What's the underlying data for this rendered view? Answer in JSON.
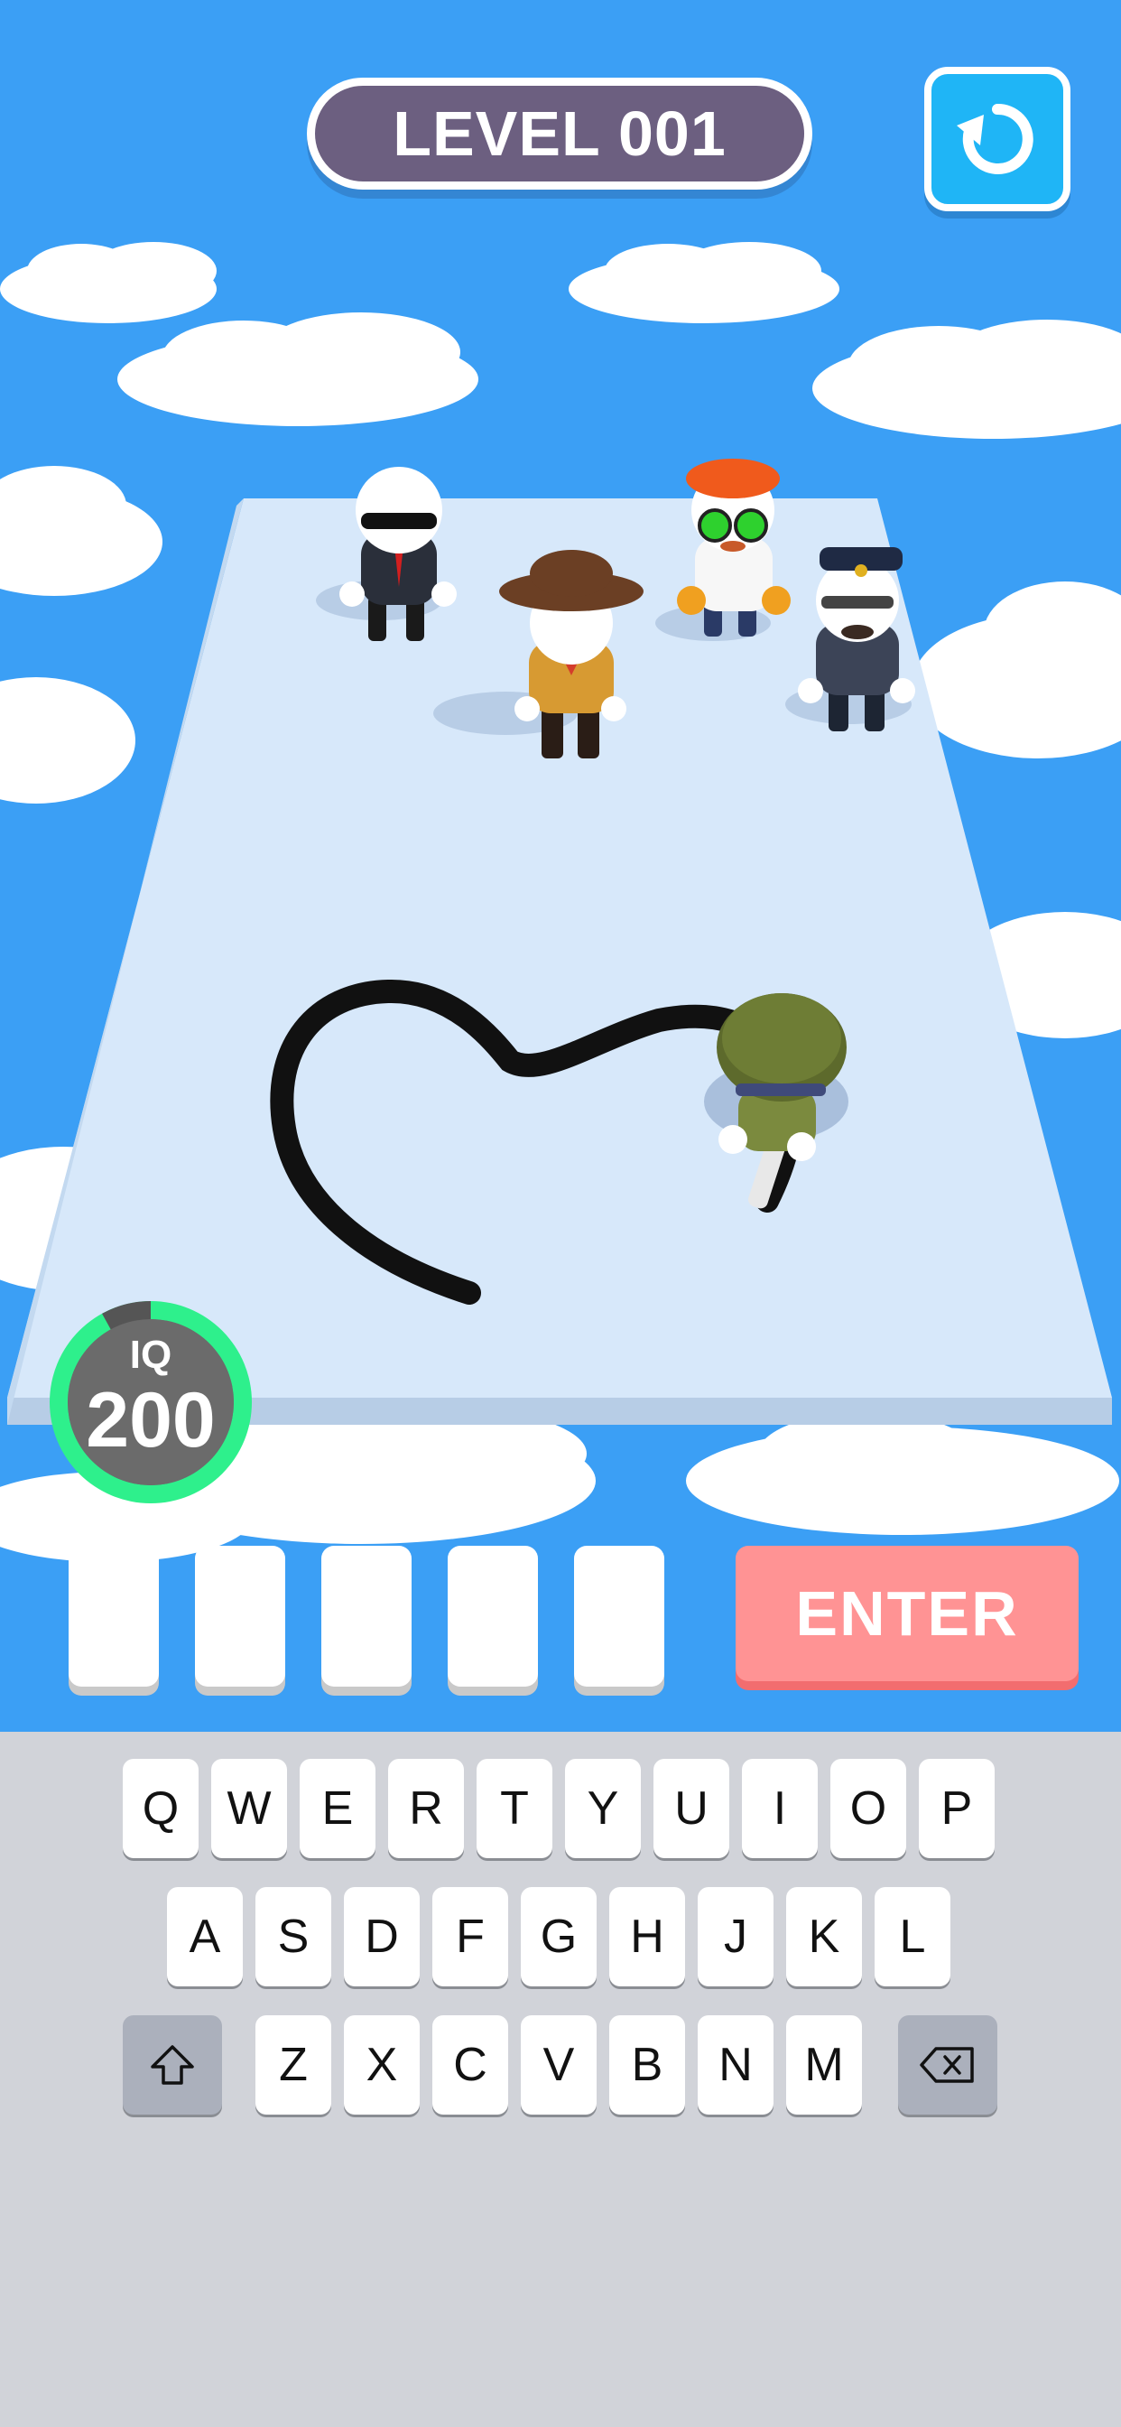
{
  "header": {
    "level_label": "LEVEL 001",
    "restart_icon": "restart-icon"
  },
  "iq": {
    "label": "IQ",
    "value": "200",
    "ring_progress_percent": 92
  },
  "answer": {
    "slot_count": 5,
    "enter_label": "ENTER"
  },
  "characters": [
    "secret-agent",
    "cowboy",
    "mad-scientist",
    "police-officer",
    "soldier"
  ],
  "keyboard": {
    "row1": [
      "Q",
      "W",
      "E",
      "R",
      "T",
      "Y",
      "U",
      "I",
      "O",
      "P"
    ],
    "row2": [
      "A",
      "S",
      "D",
      "F",
      "G",
      "H",
      "J",
      "K",
      "L"
    ],
    "row3": [
      "Z",
      "X",
      "C",
      "V",
      "B",
      "N",
      "M"
    ],
    "shift_icon": "shift-icon",
    "backspace_icon": "backspace-icon"
  },
  "colors": {
    "sky": "#3b9ff5",
    "level_pill": "#6c5f80",
    "restart": "#1fb5f6",
    "iq_ring": "#2ef08c",
    "enter": "#ff9394",
    "keyboard_bg": "#d1d3d9"
  }
}
